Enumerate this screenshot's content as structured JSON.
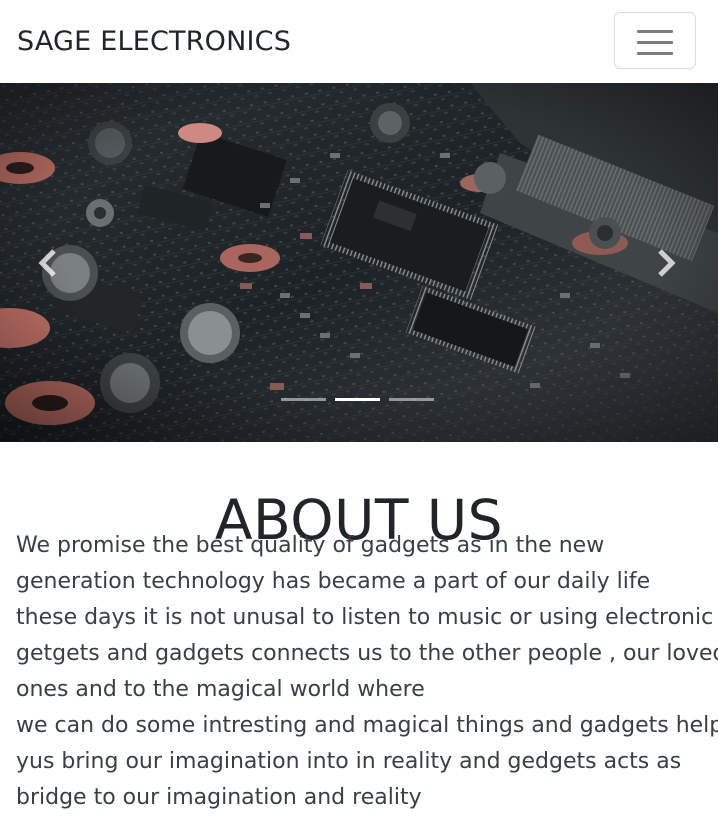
{
  "navbar": {
    "brand": "SAGE ELECTRONICS",
    "toggler_icon": "hamburger-menu-icon"
  },
  "carousel": {
    "slide_image": "circuit-board-photo",
    "prev_icon": "chevron-left-icon",
    "next_icon": "chevron-right-icon",
    "slide_count": 3,
    "active_index": 1
  },
  "about": {
    "title": "ABOUT US",
    "lines": [
      "We promise the best quality of gadgets as in the new",
      "generation technology has became a part of our daily life",
      "these days it is not unusal to listen to music or using electronic",
      "getgets and gadgets connects us to the other people , our loved",
      "ones and to the magical world where",
      "we can do some intresting and magical things and gadgets help",
      "yus bring our imagination into in reality and gedgets acts as",
      "bridge to our imagination and reality"
    ]
  },
  "colors": {
    "text": "#343a40",
    "heading": "#212529",
    "toggler_border": "#dcdcdc",
    "toggler_bars": "#7d7d7d"
  }
}
